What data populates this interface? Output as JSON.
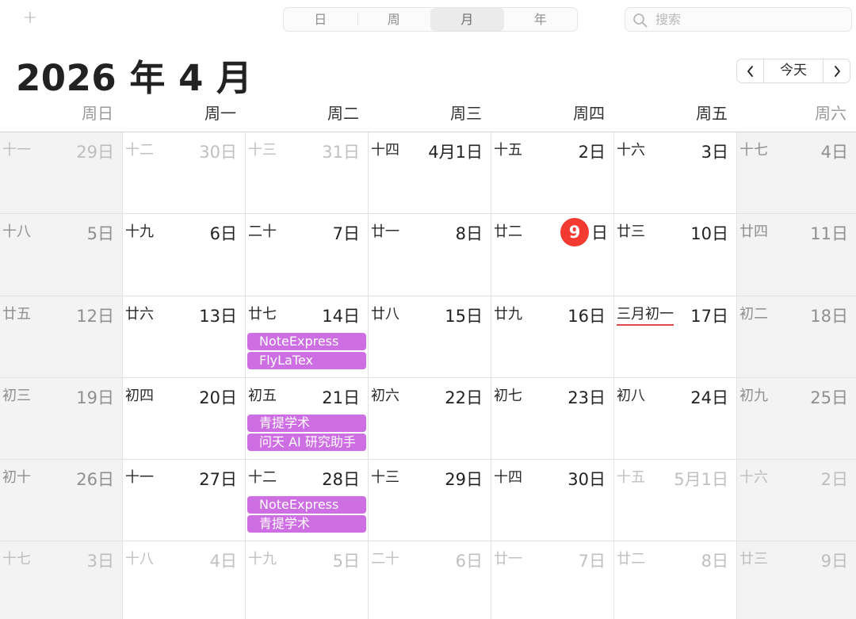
{
  "toolbar": {
    "add_label": "+",
    "views": [
      "日",
      "周",
      "月",
      "年"
    ],
    "active_view_index": 2,
    "search_placeholder": "搜索"
  },
  "header": {
    "title": "2026 年 4 月",
    "today_label": "今天",
    "prev_icon": "chevron-left-icon",
    "next_icon": "chevron-right-icon"
  },
  "weekdays": [
    "周日",
    "周一",
    "周二",
    "周三",
    "周四",
    "周五",
    "周六"
  ],
  "colors": {
    "event": "#cd6fe3",
    "today": "#f23a31",
    "festival_underline": "#e5484d"
  },
  "weeks": [
    [
      {
        "lunar": "十一",
        "day": "29日",
        "dim": true
      },
      {
        "lunar": "十二",
        "day": "30日",
        "dim": true
      },
      {
        "lunar": "十三",
        "day": "31日",
        "dim": true
      },
      {
        "lunar": "十四",
        "day": "4月1日"
      },
      {
        "lunar": "十五",
        "day": "2日"
      },
      {
        "lunar": "十六",
        "day": "3日"
      },
      {
        "lunar": "十七",
        "day": "4日"
      }
    ],
    [
      {
        "lunar": "十八",
        "day": "5日"
      },
      {
        "lunar": "十九",
        "day": "6日"
      },
      {
        "lunar": "二十",
        "day": "7日"
      },
      {
        "lunar": "廿一",
        "day": "8日"
      },
      {
        "lunar": "廿二",
        "day": "日",
        "today_num": "9",
        "is_today": true
      },
      {
        "lunar": "廿三",
        "day": "10日"
      },
      {
        "lunar": "廿四",
        "day": "11日"
      }
    ],
    [
      {
        "lunar": "廿五",
        "day": "12日"
      },
      {
        "lunar": "廿六",
        "day": "13日"
      },
      {
        "lunar": "廿七",
        "day": "14日",
        "events": [
          "NoteExpress",
          "FlyLaTex"
        ]
      },
      {
        "lunar": "廿八",
        "day": "15日"
      },
      {
        "lunar": "廿九",
        "day": "16日"
      },
      {
        "lunar": "三月初一",
        "day": "17日",
        "festival": true
      },
      {
        "lunar": "初二",
        "day": "18日"
      }
    ],
    [
      {
        "lunar": "初三",
        "day": "19日"
      },
      {
        "lunar": "初四",
        "day": "20日"
      },
      {
        "lunar": "初五",
        "day": "21日",
        "events": [
          "青提学术",
          "问天 AI 研究助手"
        ]
      },
      {
        "lunar": "初六",
        "day": "22日"
      },
      {
        "lunar": "初七",
        "day": "23日"
      },
      {
        "lunar": "初八",
        "day": "24日"
      },
      {
        "lunar": "初九",
        "day": "25日"
      }
    ],
    [
      {
        "lunar": "初十",
        "day": "26日"
      },
      {
        "lunar": "十一",
        "day": "27日"
      },
      {
        "lunar": "十二",
        "day": "28日",
        "events": [
          "NoteExpress",
          "青提学术"
        ]
      },
      {
        "lunar": "十三",
        "day": "29日"
      },
      {
        "lunar": "十四",
        "day": "30日"
      },
      {
        "lunar": "十五",
        "day": "5月1日",
        "dim": true
      },
      {
        "lunar": "十六",
        "day": "2日",
        "dim": true
      }
    ],
    [
      {
        "lunar": "十七",
        "day": "3日",
        "dim": true
      },
      {
        "lunar": "十八",
        "day": "4日",
        "dim": true
      },
      {
        "lunar": "十九",
        "day": "5日",
        "dim": true
      },
      {
        "lunar": "二十",
        "day": "6日",
        "dim": true
      },
      {
        "lunar": "廿一",
        "day": "7日",
        "dim": true
      },
      {
        "lunar": "廿二",
        "day": "8日",
        "dim": true
      },
      {
        "lunar": "廿三",
        "day": "9日",
        "dim": true
      }
    ]
  ]
}
